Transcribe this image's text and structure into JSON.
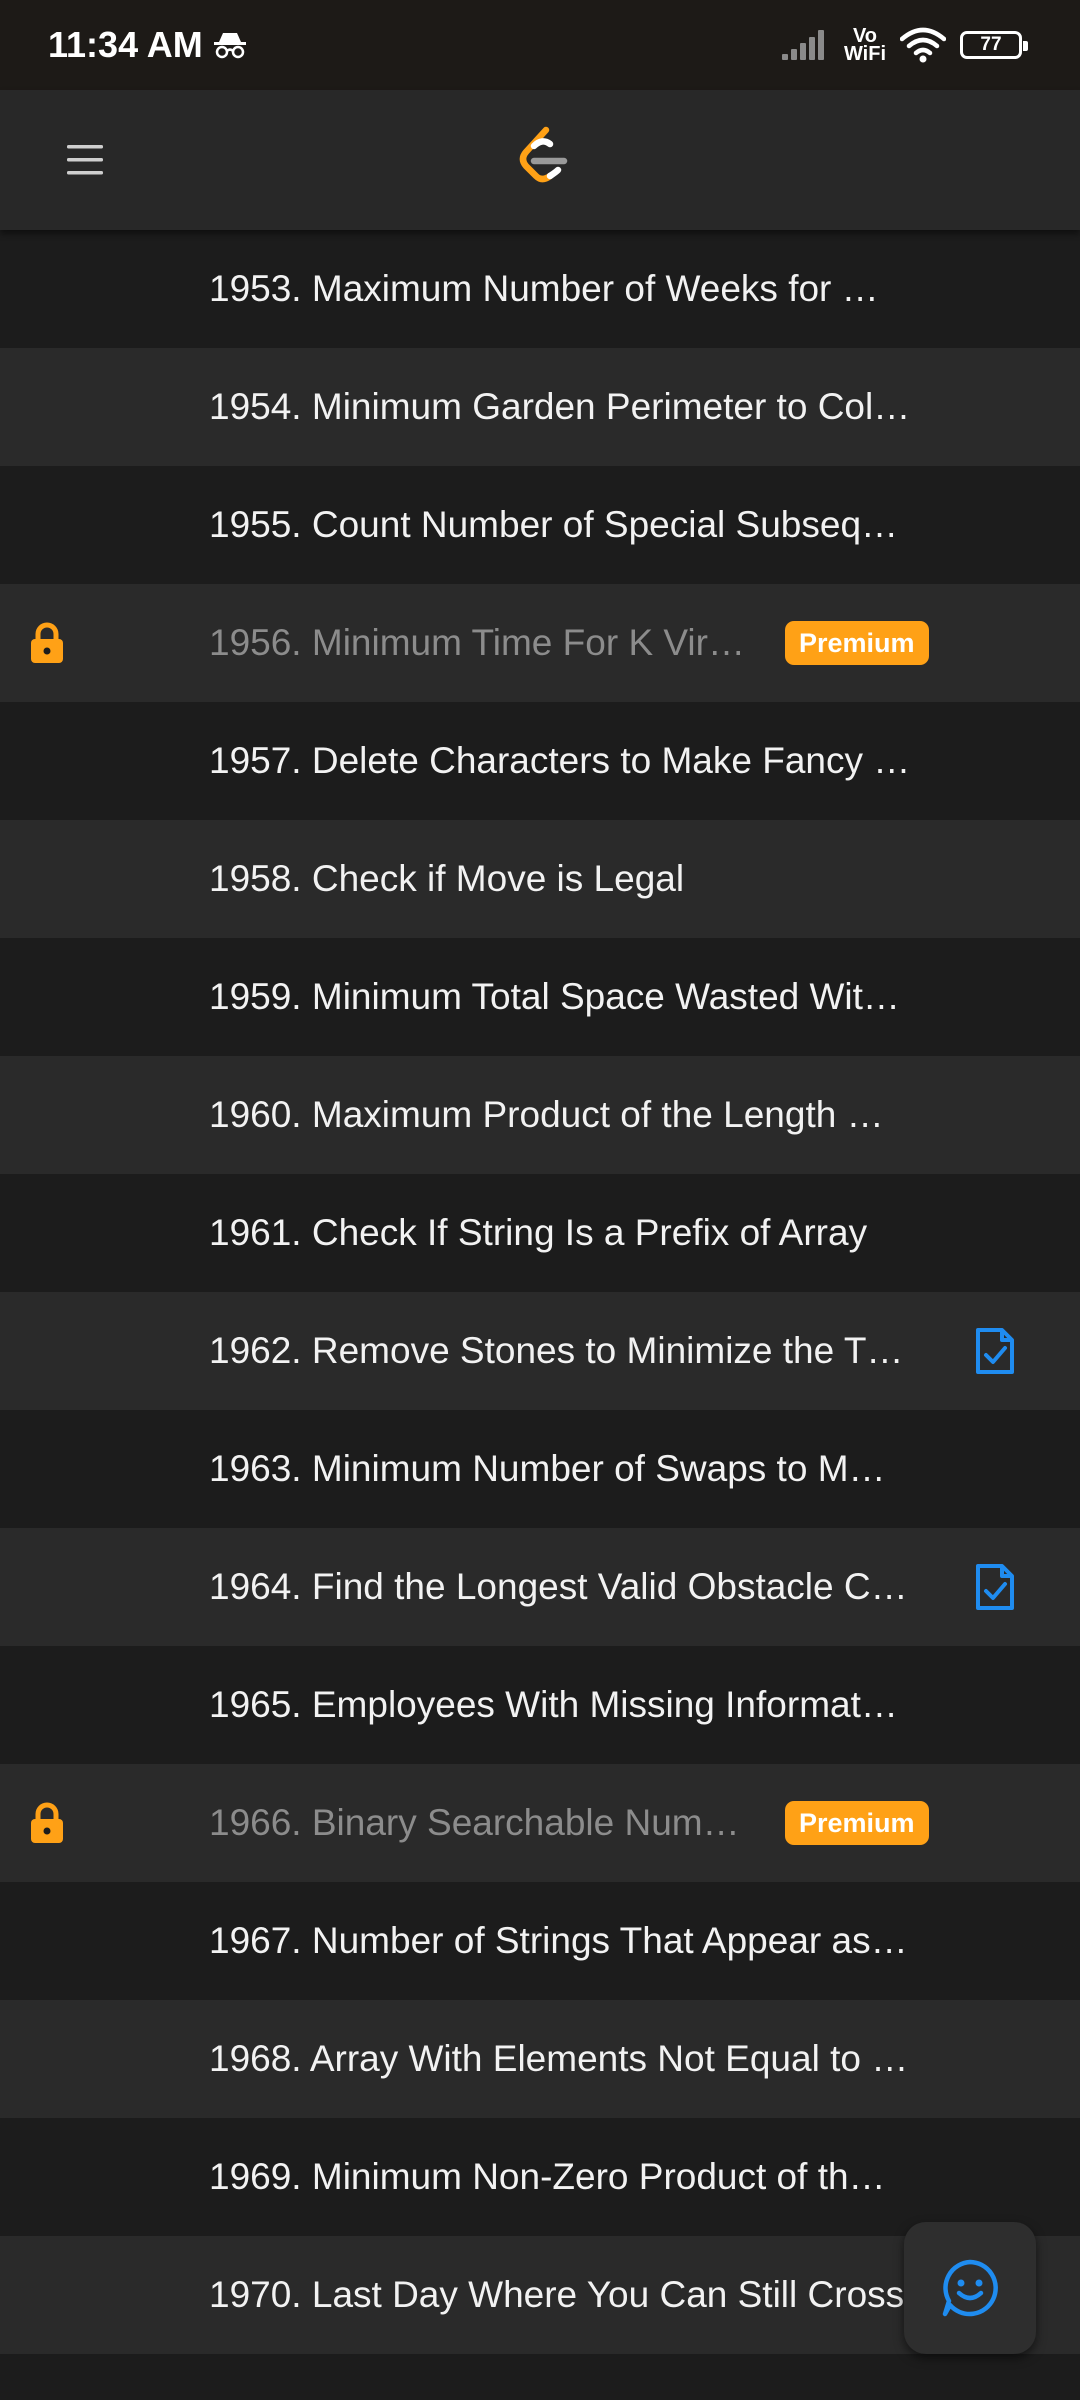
{
  "status_bar": {
    "time": "11:34 AM",
    "vowifi_top": "Vo",
    "vowifi_bottom": "WiFi",
    "battery": "77",
    "icons": [
      "incognito-icon",
      "signal-icon",
      "wifi-icon",
      "battery-icon"
    ]
  },
  "app_bar": {
    "menu_icon": "hamburger-menu-icon",
    "logo": "leetcode-logo",
    "logo_color": "#ffa116"
  },
  "problems": [
    {
      "title": "1953. Maximum Number of Weeks for …",
      "locked": false,
      "premium": false,
      "solution": false
    },
    {
      "title": "1954. Minimum Garden Perimeter to Col…",
      "locked": false,
      "premium": false,
      "solution": false
    },
    {
      "title": "1955. Count Number of Special Subseq…",
      "locked": false,
      "premium": false,
      "solution": false
    },
    {
      "title": "1956. Minimum Time For K Vir…",
      "locked": true,
      "premium": true,
      "solution": false
    },
    {
      "title": "1957. Delete Characters to Make Fancy …",
      "locked": false,
      "premium": false,
      "solution": false
    },
    {
      "title": "1958. Check if Move is Legal",
      "locked": false,
      "premium": false,
      "solution": false
    },
    {
      "title": "1959. Minimum Total Space Wasted Wit…",
      "locked": false,
      "premium": false,
      "solution": false
    },
    {
      "title": "1960. Maximum Product of the Length …",
      "locked": false,
      "premium": false,
      "solution": false
    },
    {
      "title": "1961. Check If String Is a Prefix of Array",
      "locked": false,
      "premium": false,
      "solution": false
    },
    {
      "title": "1962. Remove Stones to Minimize the T…",
      "locked": false,
      "premium": false,
      "solution": true
    },
    {
      "title": "1963. Minimum Number of Swaps to M…",
      "locked": false,
      "premium": false,
      "solution": false
    },
    {
      "title": "1964. Find the Longest Valid Obstacle C…",
      "locked": false,
      "premium": false,
      "solution": true
    },
    {
      "title": "1965. Employees With Missing Informat…",
      "locked": false,
      "premium": false,
      "solution": false
    },
    {
      "title": "1966. Binary Searchable Num…",
      "locked": true,
      "premium": true,
      "solution": false
    },
    {
      "title": "1967. Number of Strings That Appear as…",
      "locked": false,
      "premium": false,
      "solution": false
    },
    {
      "title": "1968. Array With Elements Not Equal to …",
      "locked": false,
      "premium": false,
      "solution": false
    },
    {
      "title": "1969. Minimum Non-Zero Product of th…",
      "locked": false,
      "premium": false,
      "solution": false
    },
    {
      "title": "1970. Last Day Where You Can Still Cross",
      "locked": false,
      "premium": false,
      "solution": false
    }
  ],
  "badge": {
    "premium_label": "Premium"
  },
  "colors": {
    "accent": "#ffa116",
    "solution_blue": "#1f8cf0",
    "row_dark": "#1c1c1c",
    "row_light": "#2a2a2a"
  },
  "feedback_button": {
    "icon": "smile-icon"
  }
}
